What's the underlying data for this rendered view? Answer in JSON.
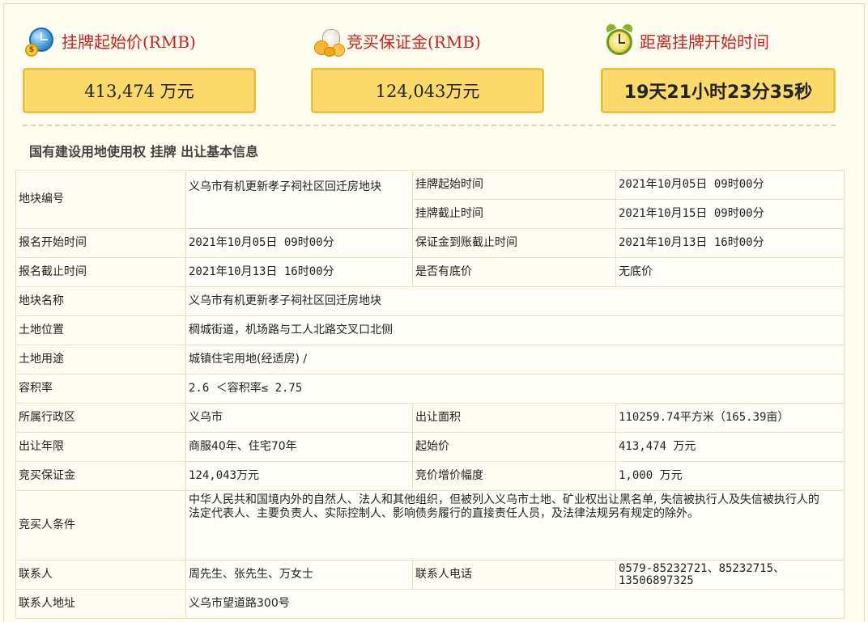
{
  "stats": {
    "start_price": {
      "label": "挂牌起始价(RMB)",
      "value": "413,474 万元",
      "icon": "clock-globe-coin-icon"
    },
    "deposit": {
      "label": "竞买保证金(RMB)",
      "value": "124,043万元",
      "icon": "money-bag-icon"
    },
    "countdown": {
      "label": "距离挂牌开始时间",
      "value": "19天21小时23分35秒",
      "icon": "alarm-clock-icon"
    }
  },
  "section_title": "国有建设用地使用权 挂牌 出让基本信息",
  "table": {
    "plot_no_label": "地块编号",
    "plot_no": "义乌市有机更新孝子祠社区回迁房地块",
    "listing_start_label": "挂牌起始时间",
    "listing_start": "2021年10月05日 09时00分",
    "listing_end_label": "挂牌截止时间",
    "listing_end": "2021年10月15日 09时00分",
    "reg_start_label": "报名开始时间",
    "reg_start": "2021年10月05日 09时00分",
    "deposit_deadline_label": "保证金到账截止时间",
    "deposit_deadline": "2021年10月13日 16时00分",
    "reg_end_label": "报名截止时间",
    "reg_end": "2021年10月13日 16时00分",
    "reserve_label": "是否有底价",
    "reserve": "无底价",
    "plot_name_label": "地块名称",
    "plot_name": "义乌市有机更新孝子祠社区回迁房地块",
    "location_label": "土地位置",
    "location": "稠城街道，机场路与工人北路交叉口北侧",
    "usage_label": "土地用途",
    "usage": "城镇住宅用地(经适房) /",
    "far_label": "容积率",
    "far": "2.6 ＜容积率≤ 2.75",
    "district_label": "所属行政区",
    "district": "义乌市",
    "area_label": "出让面积",
    "area": "110259.74平方米（165.39亩）",
    "term_label": "出让年限",
    "term": "商服40年、住宅70年",
    "start_price_label": "起始价",
    "start_price": "413,474 万元",
    "deposit_label": "竞买保证金",
    "deposit": "124,043万元",
    "increment_label": "竞价增价幅度",
    "increment": "1,000 万元",
    "conditions_label": "竞买人条件",
    "conditions": "中华人民共和国境内外的自然人、法人和其他组织，但被列入义乌市土地、矿业权出让黑名单, 失信被执行人及失信被执行人的法定代表人、主要负责人、实际控制人、影响债务履行的直接责任人员，及法律法规另有规定的除外。",
    "contact_label": "联系人",
    "contact": "周先生、张先生、万女士",
    "phone_label": "联系人电话",
    "phone": "0579-85232721、85232715、13506897325",
    "address_label": "联系人地址",
    "address": "义乌市望道路300号"
  },
  "colors": {
    "title_red": "#cc1f1f",
    "box_fill": "#fbd96a",
    "box_border": "#f3c12e",
    "page_bg": "#fffdf0"
  }
}
